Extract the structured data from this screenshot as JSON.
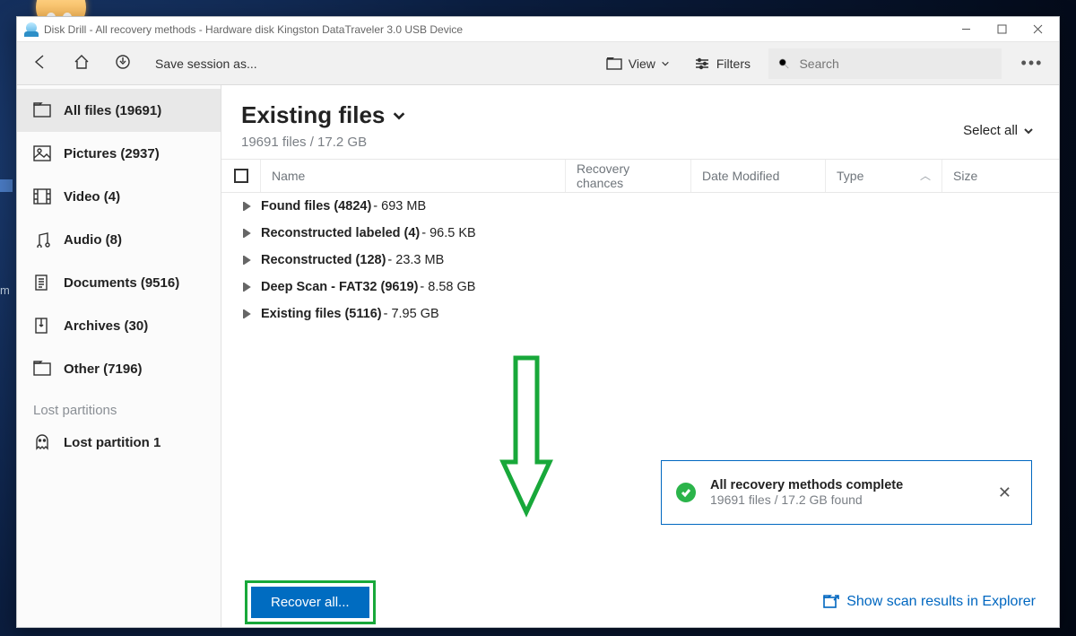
{
  "window": {
    "title": "Disk Drill - All recovery methods - Hardware disk Kingston DataTraveler 3.0 USB Device"
  },
  "toolbar": {
    "save_session": "Save session as...",
    "view": "View",
    "filters": "Filters",
    "search_placeholder": "Search"
  },
  "sidebar": {
    "items": [
      {
        "label": "All files (19691)"
      },
      {
        "label": "Pictures (2937)"
      },
      {
        "label": "Video (4)"
      },
      {
        "label": "Audio (8)"
      },
      {
        "label": "Documents (9516)"
      },
      {
        "label": "Archives (30)"
      },
      {
        "label": "Other (7196)"
      }
    ],
    "section": "Lost partitions",
    "lost_partition": "Lost partition 1"
  },
  "main": {
    "title": "Existing files",
    "subtitle": "19691 files / 17.2 GB",
    "select_all": "Select all",
    "columns": {
      "name": "Name",
      "recovery": "Recovery chances",
      "modified": "Date Modified",
      "type": "Type",
      "size": "Size"
    },
    "rows": [
      {
        "label": "Found files (4824)",
        "meta": "- 693 MB"
      },
      {
        "label": "Reconstructed labeled (4)",
        "meta": "- 96.5 KB"
      },
      {
        "label": "Reconstructed (128)",
        "meta": "- 23.3 MB"
      },
      {
        "label": "Deep Scan - FAT32 (9619)",
        "meta": "- 8.58 GB"
      },
      {
        "label": "Existing files (5116)",
        "meta": "- 7.95 GB"
      }
    ]
  },
  "toast": {
    "title": "All recovery methods complete",
    "subtitle": "19691 files / 17.2 GB found"
  },
  "footer": {
    "recover": "Recover all...",
    "explorer": "Show scan results in Explorer"
  }
}
